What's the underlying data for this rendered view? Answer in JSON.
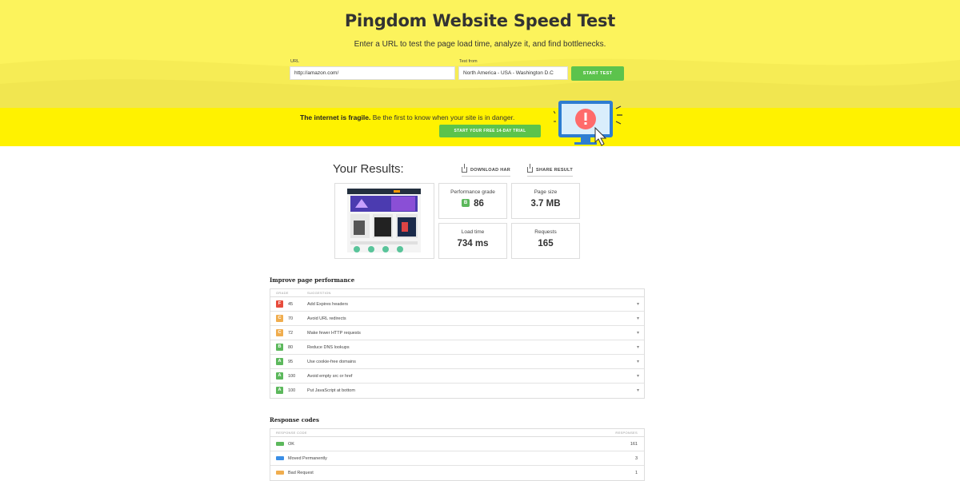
{
  "header": {
    "title": "Pingdom Website Speed Test",
    "subtitle": "Enter a URL to test the page load time, analyze it, and find bottlenecks.",
    "url_label": "URL",
    "url_value": "http://amazon.com/",
    "test_from_label": "Test from",
    "test_from_value": "North America - USA - Washington D.C",
    "start_button": "START TEST"
  },
  "banner": {
    "bold_text": "The internet is fragile.",
    "text": " Be the first to know when your site is in danger.",
    "trial_button": "START YOUR FREE 14-DAY TRIAL",
    "icon": "alert-monitor-icon"
  },
  "results": {
    "title": "Your Results:",
    "download_har": "DOWNLOAD HAR",
    "share_result": "SHARE RESULT",
    "performance_grade_label": "Performance grade",
    "performance_grade_letter": "B",
    "performance_grade_value": "86",
    "page_size_label": "Page size",
    "page_size_value": "3.7 MB",
    "load_time_label": "Load time",
    "load_time_value": "734 ms",
    "requests_label": "Requests",
    "requests_value": "165"
  },
  "performance": {
    "title": "Improve page performance",
    "col_grade": "GRADE",
    "col_suggestion": "SUGGESTION",
    "rows": [
      {
        "grade": "F",
        "score": "45",
        "suggestion": "Add Expires headers",
        "color": "#e74c3c"
      },
      {
        "grade": "C",
        "score": "70",
        "suggestion": "Avoid URL redirects",
        "color": "#f0ad4e"
      },
      {
        "grade": "C",
        "score": "72",
        "suggestion": "Make fewer HTTP requests",
        "color": "#f0ad4e"
      },
      {
        "grade": "B",
        "score": "80",
        "suggestion": "Reduce DNS lookups",
        "color": "#5cb85c"
      },
      {
        "grade": "A",
        "score": "95",
        "suggestion": "Use cookie-free domains",
        "color": "#5cb85c"
      },
      {
        "grade": "A",
        "score": "100",
        "suggestion": "Avoid empty src or href",
        "color": "#5cb85c"
      },
      {
        "grade": "A",
        "score": "100",
        "suggestion": "Put JavaScript at bottom",
        "color": "#5cb85c"
      }
    ]
  },
  "response_codes": {
    "title": "Response codes",
    "col_code": "RESPONSE CODE",
    "col_responses": "RESPONSES",
    "rows": [
      {
        "label": "OK",
        "count": "161",
        "color": "#5cb85c"
      },
      {
        "label": "Moved Permanently",
        "count": "3",
        "color": "#3a8ee6"
      },
      {
        "label": "Bad Request",
        "count": "1",
        "color": "#f0ad4e"
      }
    ]
  }
}
